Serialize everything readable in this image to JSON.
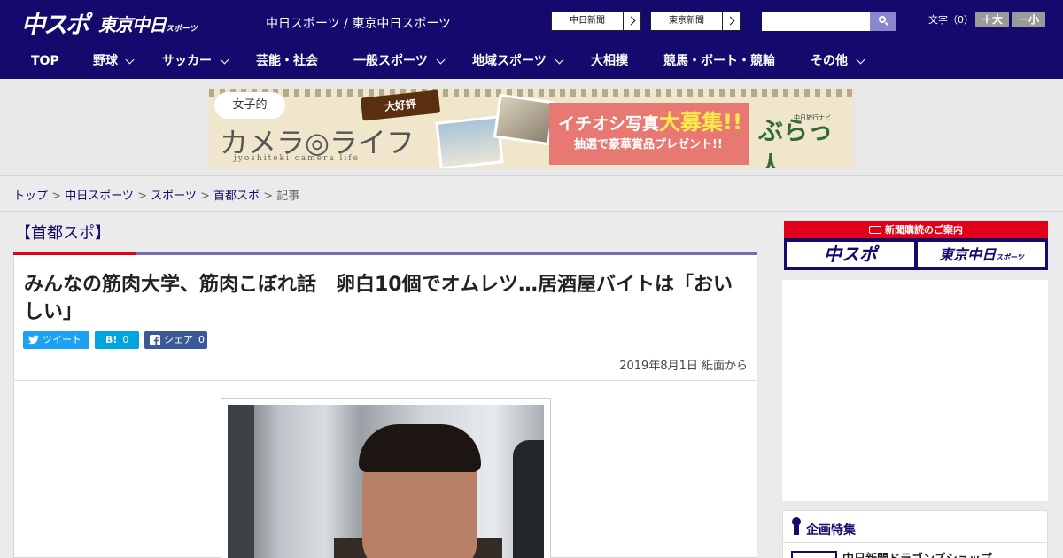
{
  "header": {
    "logo_chunichi": "中スポ",
    "logo_tokyo": "東京中日",
    "logo_tokyo_small": "スポーツ",
    "site_links": "中日スポーツ / 東京中日スポーツ",
    "newspaper_buttons": [
      "中日新聞",
      "東京新聞"
    ],
    "search_placeholder": "",
    "font_size_label": "文字（0）",
    "font_plus": "＋大",
    "font_minus": "－小"
  },
  "nav": {
    "items": [
      "TOP",
      "野球",
      "サッカー",
      "芸能・社会",
      "一般スポーツ",
      "地域スポーツ",
      "大相撲",
      "競馬・ボート・競輪",
      "その他"
    ]
  },
  "banner": {
    "bubble": "女子的",
    "title": "カメラ◎ライフ",
    "subtitle": "jyoshiteki camera life",
    "tag": "大好評",
    "pink_line1_prefix": "イチオシ写真",
    "pink_line1_highlight": "大募集!!",
    "pink_line2": "抽選で豪華賞品プレゼント!!",
    "brand_small": "中日旅行ナビ",
    "brand": "ぶらっ人"
  },
  "breadcrumb": {
    "items": [
      "トップ",
      "中日スポーツ",
      "スポーツ",
      "首都スポ"
    ],
    "current": "記事",
    "sep": " > "
  },
  "article": {
    "section": "【首都スポ】",
    "headline": "みんなの筋肉大学、筋肉こぼれ話　卵白10個でオムレツ…居酒屋バイトは「おいしい」",
    "share": {
      "tweet_label": "ツイート",
      "hatena_label": "B!",
      "hatena_count": "0",
      "facebook_label": "シェア",
      "facebook_count": "0"
    },
    "dateline": "2019年8月1日 紙面から"
  },
  "sidebar": {
    "newspaper_box_title": "新聞購読のご案内",
    "newspaper_box_logo1": "中スポ",
    "newspaper_box_logo2": "東京中日",
    "newspaper_box_logo2_small": "スポーツ",
    "feature_title": "企画特集",
    "feature_item": "中日新聞ドラゴンズショップ"
  },
  "colors": {
    "brand_navy": "#140a6e",
    "accent_red": "#e0001a",
    "twitter": "#1da1f2",
    "hatena": "#00a4de",
    "facebook": "#3b5998"
  }
}
